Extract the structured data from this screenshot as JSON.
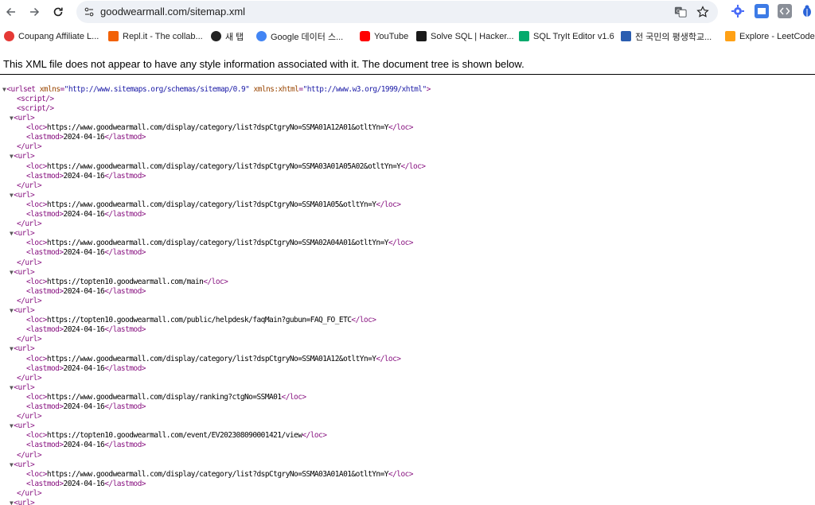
{
  "browser": {
    "url": "goodwearmall.com/sitemap.xml"
  },
  "bookmarks": [
    {
      "label": "Coupang Affiliate L...",
      "color": "#e53935"
    },
    {
      "label": "Repl.it - The collab...",
      "color": "#f26207"
    },
    {
      "label": "새 탭",
      "color": "#222222"
    },
    {
      "label": "Google 데이터 스...",
      "color": "#4285f4"
    },
    {
      "label": "YouTube",
      "color": "#ff0000"
    },
    {
      "label": "Solve SQL | Hacker...",
      "color": "#1ba94c"
    },
    {
      "label": "SQL TryIt Editor v1.6",
      "color": "#04aa6d"
    },
    {
      "label": "전 국민의 평생학교...",
      "color": "#2a5db0"
    },
    {
      "label": "Explore - LeetCode",
      "color": "#ffa116"
    }
  ],
  "notice": {
    "text": "This XML file does not appear to have any style information associated with it. The document tree is shown below."
  },
  "xml": {
    "root_open_tag": "<urlset",
    "root_attr1_name": "xmlns",
    "root_attr1_value": "\"http://www.sitemaps.org/schemas/sitemap/0.9\"",
    "root_attr2_name": "xmlns:xhtml",
    "root_attr2_value": "\"http://www.w3.org/1999/xhtml\"",
    "root_close": ">",
    "script_tag": "<script/>",
    "url_open": "<url>",
    "url_close": "</url>",
    "loc_open": "<loc>",
    "loc_close": "</loc>",
    "lastmod_open": "<lastmod>",
    "lastmod_close": "</lastmod>",
    "entries": [
      {
        "loc": "https://www.goodwearmall.com/display/category/list?dspCtgryNo=SSMA01A12A01&otltYn=Y",
        "lastmod": "2024-04-16"
      },
      {
        "loc": "https://www.goodwearmall.com/display/category/list?dspCtgryNo=SSMA03A01A05A02&otltYn=Y",
        "lastmod": "2024-04-16"
      },
      {
        "loc": "https://www.goodwearmall.com/display/category/list?dspCtgryNo=SSMA01A05&otltYn=Y",
        "lastmod": "2024-04-16"
      },
      {
        "loc": "https://www.goodwearmall.com/display/category/list?dspCtgryNo=SSMA02A04A01&otltYn=Y",
        "lastmod": "2024-04-16"
      },
      {
        "loc": "https://topten10.goodwearmall.com/main",
        "lastmod": "2024-04-16"
      },
      {
        "loc": "https://topten10.goodwearmall.com/public/helpdesk/faqMain?gubun=FAQ_FO_ETC",
        "lastmod": "2024-04-16"
      },
      {
        "loc": "https://www.goodwearmall.com/display/category/list?dspCtgryNo=SSMA01A12&otltYn=Y",
        "lastmod": "2024-04-16"
      },
      {
        "loc": "https://www.goodwearmall.com/display/ranking?ctgNo=SSMA01",
        "lastmod": "2024-04-16"
      },
      {
        "loc": "https://topten10.goodwearmall.com/event/EV202308090001421/view",
        "lastmod": "2024-04-16"
      },
      {
        "loc": "https://www.goodwearmall.com/display/category/list?dspCtgryNo=SSMA03A01A01&otltYn=Y",
        "lastmod": "2024-04-16"
      }
    ]
  }
}
